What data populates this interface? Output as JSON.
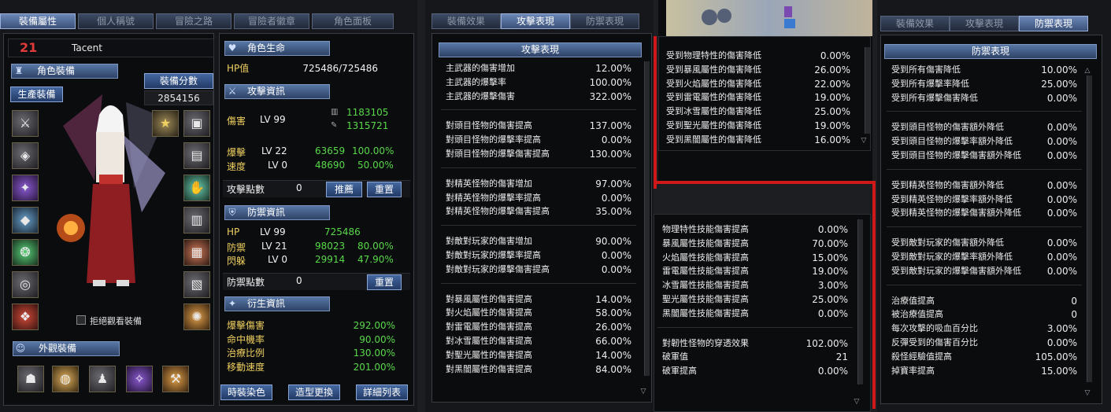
{
  "char_tabs": [
    "裝備屬性",
    "個人稱號",
    "冒險之路",
    "冒險者徽章",
    "角色面板"
  ],
  "level": "21",
  "name": "Tacent",
  "equip_section": "角色裝備",
  "equip_score_label": "裝備分數",
  "equip_score": "2854156",
  "life_skill_btn": "生產裝備",
  "refuse_view": "拒絕觀看裝備",
  "appearance_section": "外觀裝備",
  "life_section": "角色生命",
  "hp_label": "HP值",
  "hp_value": "725486/725486",
  "attack_section": "攻擊資訊",
  "attack": {
    "dmg_label": "傷害",
    "dmg_lv": "LV 99",
    "dmg_a": "1183105",
    "dmg_b": "1315721",
    "crit_label": "爆擊",
    "crit_lv": "LV 22",
    "crit_val": "63659",
    "crit_pct": "100.00%",
    "speed_label": "速度",
    "speed_lv": "LV 0",
    "speed_val": "48690",
    "speed_pct": "50.00%",
    "points_label": "攻擊點數",
    "points": "0",
    "recommend_btn": "推薦",
    "reset_btn": "重置"
  },
  "defense_section": "防禦資訊",
  "defense": {
    "hp_label": "HP",
    "hp_lv": "LV 99",
    "hp_val": "725486",
    "def_label": "防禦",
    "def_lv": "LV 21",
    "def_val": "98023",
    "def_pct": "80.00%",
    "eva_label": "閃躲",
    "eva_lv": "LV 0",
    "eva_val": "29914",
    "eva_pct": "47.90%",
    "points_label": "防禦點數",
    "points": "0",
    "reset_btn": "重置"
  },
  "derived_section": "衍生資訊",
  "derived": [
    {
      "label": "爆擊傷害",
      "value": "292.00%"
    },
    {
      "label": "命中機率",
      "value": "90.00%"
    },
    {
      "label": "治療比例",
      "value": "130.00%"
    },
    {
      "label": "移動速度",
      "value": "201.00%"
    }
  ],
  "bottom_buttons": [
    "時裝染色",
    "造型更換",
    "詳細列表"
  ],
  "stat_tabs": [
    "裝備效果",
    "攻擊表現",
    "防禦表現"
  ],
  "attack_perf_title": "攻擊表現",
  "attack_perf_groups": [
    [
      [
        "主武器的傷害增加",
        "12.00%"
      ],
      [
        "主武器的爆擊率",
        "100.00%"
      ],
      [
        "主武器的爆擊傷害",
        "322.00%"
      ]
    ],
    [
      [
        "對頭目怪物的傷害提高",
        "137.00%"
      ],
      [
        "對頭目怪物的爆擊率提高",
        "0.00%"
      ],
      [
        "對頭目怪物的爆擊傷害提高",
        "130.00%"
      ]
    ],
    [
      [
        "對精英怪物的傷害增加",
        "97.00%"
      ],
      [
        "對精英怪物的爆擊率提高",
        "0.00%"
      ],
      [
        "對精英怪物的爆擊傷害提高",
        "35.00%"
      ]
    ],
    [
      [
        "對敵對玩家的傷害增加",
        "90.00%"
      ],
      [
        "對敵對玩家的爆擊率提高",
        "0.00%"
      ],
      [
        "對敵對玩家的爆擊傷害提高",
        "0.00%"
      ]
    ],
    [
      [
        "對暴風屬性的傷害提高",
        "14.00%"
      ],
      [
        "對火焰屬性的傷害提高",
        "58.00%"
      ],
      [
        "對雷電屬性的傷害提高",
        "26.00%"
      ],
      [
        "對冰雪屬性的傷害提高",
        "66.00%"
      ],
      [
        "對聖光屬性的傷害提高",
        "14.00%"
      ],
      [
        "對黑闇屬性的傷害提高",
        "84.00%"
      ]
    ]
  ],
  "middle_top_rows": [
    [
      "受到物理特性的傷害降低",
      "0.00%"
    ],
    [
      "受到暴風屬性的傷害降低",
      "26.00%"
    ],
    [
      "受到火焰屬性的傷害降低",
      "22.00%"
    ],
    [
      "受到雷電屬性的傷害降低",
      "19.00%"
    ],
    [
      "受到冰雪屬性的傷害降低",
      "25.00%"
    ],
    [
      "受到聖光屬性的傷害降低",
      "19.00%"
    ],
    [
      "受到黑闇屬性的傷害降低",
      "16.00%"
    ]
  ],
  "middle_bottom_groups": [
    [
      [
        "物理特性技能傷害提高",
        "0.00%"
      ],
      [
        "暴風屬性技能傷害提高",
        "70.00%"
      ],
      [
        "火焰屬性技能傷害提高",
        "15.00%"
      ],
      [
        "雷電屬性技能傷害提高",
        "19.00%"
      ],
      [
        "冰雪屬性技能傷害提高",
        "3.00%"
      ],
      [
        "聖光屬性技能傷害提高",
        "25.00%"
      ],
      [
        "黑闇屬性技能傷害提高",
        "0.00%"
      ]
    ],
    [
      [
        "對韌性怪物的穿透效果",
        "102.00%"
      ],
      [
        "破軍值",
        "21"
      ],
      [
        "破軍提高",
        "0.00%"
      ]
    ]
  ],
  "def_perf_title": "防禦表現",
  "def_perf_groups": [
    [
      [
        "受到所有傷害降低",
        "10.00%"
      ],
      [
        "受到所有爆擊率降低",
        "25.00%"
      ],
      [
        "受到所有爆擊傷害降低",
        "0.00%"
      ]
    ],
    [
      [
        "受到頭目怪物的傷害額外降低",
        "0.00%"
      ],
      [
        "受到頭目怪物的爆擊率額外降低",
        "0.00%"
      ],
      [
        "受到頭目怪物的爆擊傷害額外降低",
        "0.00%"
      ]
    ],
    [
      [
        "受到精英怪物的傷害額外降低",
        "0.00%"
      ],
      [
        "受到精英怪物的爆擊率額外降低",
        "0.00%"
      ],
      [
        "受到精英怪物的爆擊傷害額外降低",
        "0.00%"
      ]
    ],
    [
      [
        "受到敵對玩家的傷害額外降低",
        "0.00%"
      ],
      [
        "受到敵對玩家的爆擊率額外降低",
        "0.00%"
      ],
      [
        "受到敵對玩家的爆擊傷害額外降低",
        "0.00%"
      ]
    ],
    [
      [
        "治療值提高",
        "0"
      ],
      [
        "被治療值提高",
        "0"
      ],
      [
        "每次攻擊的吸血百分比",
        "3.00%"
      ],
      [
        "反彈受到的傷害百分比",
        "0.00%"
      ],
      [
        "殺怪經驗值提高",
        "105.00%"
      ],
      [
        "掉寶率提高",
        "15.00%"
      ]
    ]
  ]
}
